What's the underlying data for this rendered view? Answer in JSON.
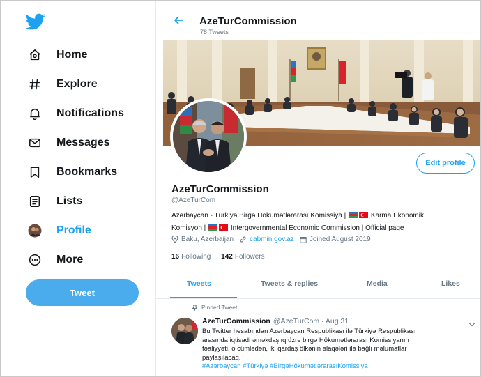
{
  "sidebar": {
    "logo_icon": "twitter-bird-icon",
    "items": [
      {
        "label": "Home",
        "icon": "home-icon"
      },
      {
        "label": "Explore",
        "icon": "hashtag-icon"
      },
      {
        "label": "Notifications",
        "icon": "bell-icon"
      },
      {
        "label": "Messages",
        "icon": "envelope-icon"
      },
      {
        "label": "Bookmarks",
        "icon": "bookmark-icon"
      },
      {
        "label": "Lists",
        "icon": "list-icon"
      },
      {
        "label": "Profile",
        "icon": "avatar-icon",
        "active": true
      },
      {
        "label": "More",
        "icon": "more-icon"
      }
    ],
    "tweet_button": "Tweet"
  },
  "header": {
    "title": "AzeTurCommission",
    "tweet_count": "78 Tweets"
  },
  "profile": {
    "edit_button": "Edit profile",
    "name": "AzeTurCommission",
    "handle": "@AzeTurCom",
    "bio_line1_a": "Azərbaycan - Türkiyə Birgə Hökumətlərarası Komissiya |",
    "bio_line1_b": "Karma Ekonomik",
    "bio_line2_a": "Komisyon |",
    "bio_line2_b": "Intergovernmental Economic Commission | Official page",
    "location": "Baku, Azerbaijan",
    "website": "cabmin.gov.az",
    "joined": "Joined August 2019",
    "following_count": "16",
    "following_label": "Following",
    "followers_count": "142",
    "followers_label": "Followers"
  },
  "tabs": [
    "Tweets",
    "Tweets & replies",
    "Media",
    "Likes"
  ],
  "pinned_tweet": {
    "pinned_label": "Pinned Tweet",
    "author": "AzeTurCommission",
    "handle_date": "@AzeTurCom · Aug 31",
    "line1": "Bu Twitter hesabından Azərbaycan Respublikası ilə Türkiyə Respublikası",
    "line2": "arasında iqtisadi əməkdaşlıq üzrə birgə Hökumətlərarası Komissiyanın",
    "line3": "fəaliyyəti, o cümlədən, iki qardaş ölkənin əlaqələri ilə bağlı məlumatlar",
    "line4": "paylaşılacaq.",
    "hashtags": "#Azərbaycan #Türkiyə #BirgəHökumətlərarasıKomissiya"
  },
  "colors": {
    "accent": "#1da1f2",
    "tweet_button": "#4aabed",
    "text": "#14171a",
    "muted": "#657786"
  }
}
